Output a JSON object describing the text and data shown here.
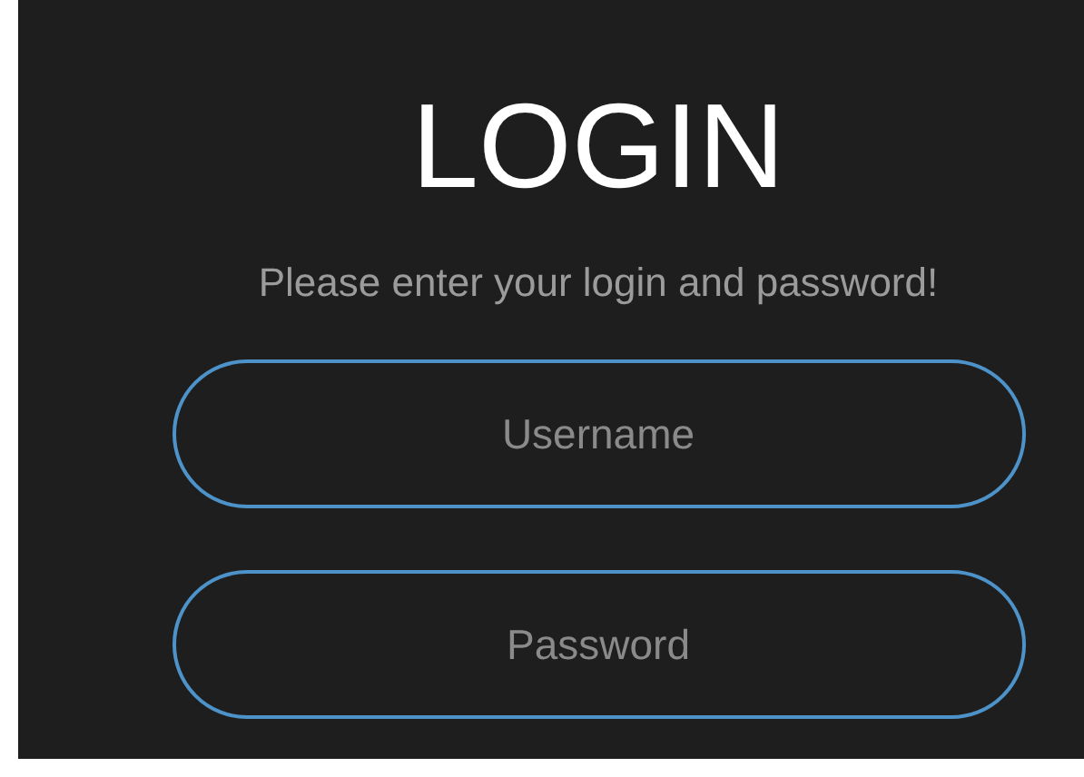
{
  "title": "LOGIN",
  "subtitle": "Please enter your login and password!",
  "fields": [
    {
      "placeholder": "Username"
    },
    {
      "placeholder": "Password"
    }
  ]
}
